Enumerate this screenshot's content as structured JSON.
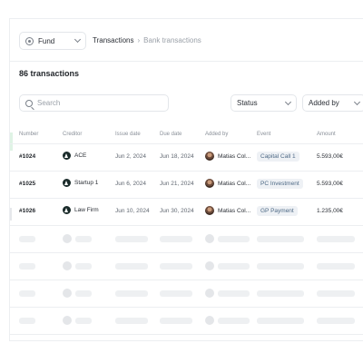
{
  "fund_select": {
    "label": "Fund",
    "icon": "fund-icon"
  },
  "breadcrumb": {
    "current": "Transactions",
    "separator": "›",
    "child": "Bank transactions"
  },
  "count_title": "86 transactions",
  "search": {
    "placeholder": "Search",
    "value": ""
  },
  "filters": {
    "status": "Status",
    "added_by": "Added by"
  },
  "columns": [
    "Number",
    "Creditor",
    "Issue date",
    "Due date",
    "Added by",
    "Event",
    "Amount"
  ],
  "rows": [
    {
      "number": "#1024",
      "creditor": "ACE",
      "issue_date": "Jun 2, 2024",
      "due_date": "Jun 18, 2024",
      "added_by": "Matias Col...",
      "event": "Capital Call 1",
      "amount": "5.593,00€"
    },
    {
      "number": "#1025",
      "creditor": "Startup 1",
      "issue_date": "Jun 6, 2024",
      "due_date": "Jun 21, 2024",
      "added_by": "Matias Col...",
      "event": "PC Investment",
      "amount": "5.593,00€"
    },
    {
      "number": "#1026",
      "creditor": "Law Firm",
      "issue_date": "Jun 10, 2024",
      "due_date": "Jun 30, 2024",
      "added_by": "Matias Col...",
      "event": "GP Payment",
      "amount": "1.235,00€"
    }
  ],
  "colors": {
    "badge_bg": "#eef1f5",
    "badge_text": "#4f6a86",
    "skeleton": "#eef0f2",
    "creditor_logo": "#1a2b2a"
  }
}
